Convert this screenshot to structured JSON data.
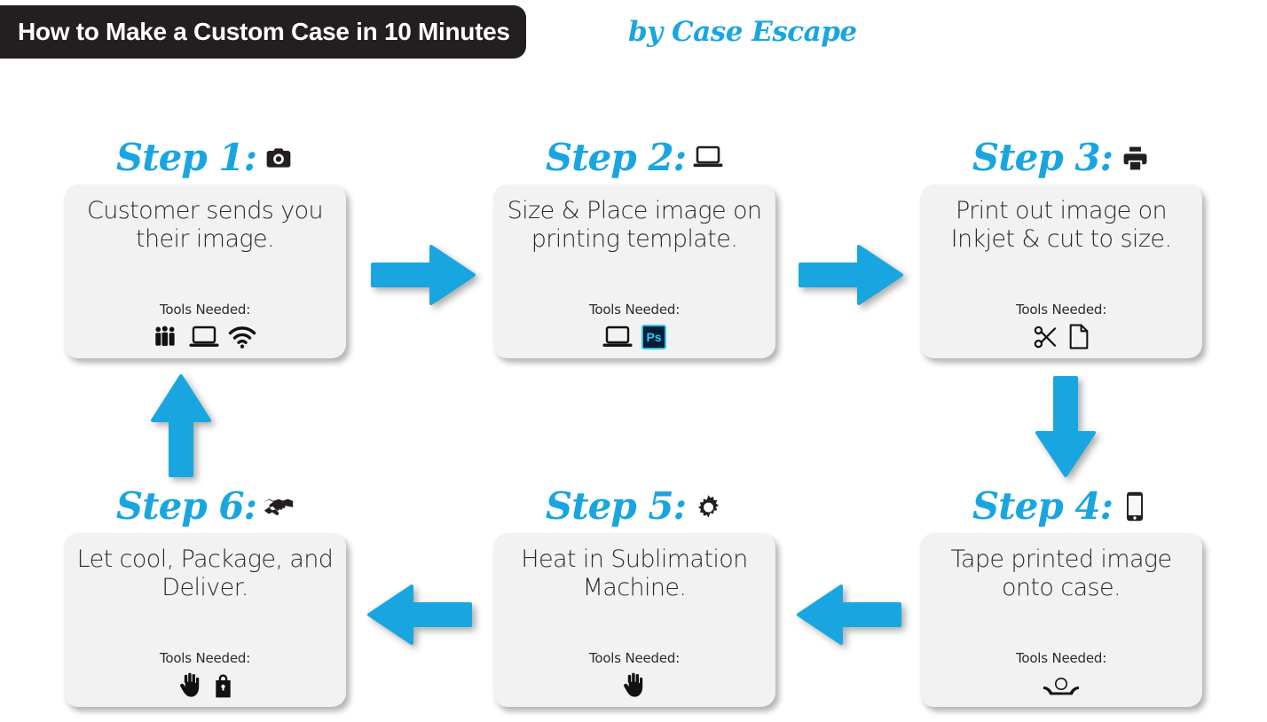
{
  "header": {
    "title": "How to Make a Custom Case in 10 Minutes",
    "brand": "by Case Escape",
    "bar_color": "#231f20",
    "accent_color": "#19A6E0"
  },
  "labels": {
    "tools_needed": "Tools Needed:"
  },
  "steps": [
    {
      "label": "Step 1:",
      "head_icon": "camera-icon",
      "text": "Customer sends you their image.",
      "tools_label": "Tools Needed:",
      "tools": [
        "people-group-icon",
        "laptop-icon",
        "wifi-icon"
      ]
    },
    {
      "label": "Step 2:",
      "head_icon": "laptop-icon",
      "text": "Size & Place image on printing template.",
      "tools_label": "Tools Needed:",
      "tools": [
        "laptop-icon",
        "photoshop-icon"
      ],
      "photoshop_text": "Ps"
    },
    {
      "label": "Step 3:",
      "head_icon": "printer-icon",
      "text": "Print out image on Inkjet & cut to size.",
      "tools_label": "Tools Needed:",
      "tools": [
        "scissors-icon",
        "paper-page-icon"
      ]
    },
    {
      "label": "Step 4:",
      "head_icon": "smartphone-icon",
      "text": "Tape printed image onto case.",
      "tools_label": "Tools Needed:",
      "tools": [
        "tape-dispenser-icon"
      ]
    },
    {
      "label": "Step 5:",
      "head_icon": "gear-icon",
      "text": "Heat in Sublimation Machine.",
      "tools_label": "Tools Needed:",
      "tools": [
        "gloves-icon"
      ]
    },
    {
      "label": "Step 6:",
      "head_icon": "handshake-icon",
      "text": "Let cool, Package, and Deliver.",
      "tools_label": "Tools Needed:",
      "tools": [
        "gloves-icon",
        "shopping-bag-icon"
      ]
    }
  ],
  "arrows": [
    {
      "name": "arrow-step1-to-step2",
      "direction": "right",
      "color": "#19A6E0"
    },
    {
      "name": "arrow-step2-to-step3",
      "direction": "right",
      "color": "#19A6E0"
    },
    {
      "name": "arrow-step3-to-step4",
      "direction": "down",
      "color": "#19A6E0"
    },
    {
      "name": "arrow-step4-to-step5",
      "direction": "left",
      "color": "#19A6E0"
    },
    {
      "name": "arrow-step5-to-step6",
      "direction": "left",
      "color": "#19A6E0"
    },
    {
      "name": "arrow-step6-to-step1",
      "direction": "up",
      "color": "#19A6E0"
    }
  ]
}
